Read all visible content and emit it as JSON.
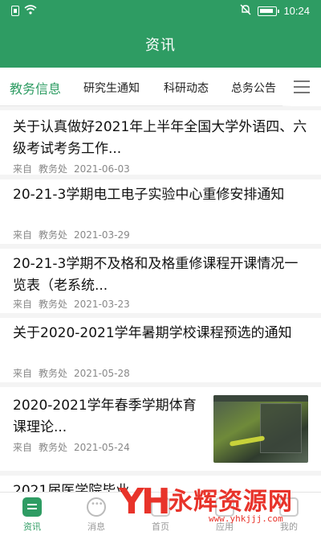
{
  "status": {
    "time": "10:24"
  },
  "header": {
    "title": "资讯"
  },
  "tabs": [
    "教务信息",
    "研究生通知",
    "科研动态",
    "总务公告"
  ],
  "articles": [
    {
      "title": "关于认真做好2021年上半年全国大学外语四、六级考试考务工作...",
      "source_label": "来自",
      "source": "教务处",
      "date": "2021-06-03"
    },
    {
      "title": "20-21-3学期电工电子实验中心重修安排通知",
      "source_label": "来自",
      "source": "教务处",
      "date": "2021-03-29"
    },
    {
      "title": "20-21-3学期不及格和及格重修课程开课情况一览表（老系统...",
      "source_label": "来自",
      "source": "教务处",
      "date": "2021-03-23"
    },
    {
      "title": "关于2020-2021学年暑期学校课程预选的通知",
      "source_label": "来自",
      "source": "教务处",
      "date": "2021-05-28"
    },
    {
      "title": "2020-2021学年春季学期体育课理论...",
      "source_label": "来自",
      "source": "教务处",
      "date": "2021-05-24",
      "has_thumbnail": true
    },
    {
      "title": "2021届医学院毕业",
      "partial": true
    }
  ],
  "bottom_nav": [
    {
      "label": "资讯",
      "icon": "document-icon",
      "active": true
    },
    {
      "label": "消息",
      "icon": "chat-icon"
    },
    {
      "label": "首页",
      "icon": "home-icon"
    },
    {
      "label": "应用",
      "icon": "apps-icon"
    },
    {
      "label": "我的",
      "icon": "user-icon"
    }
  ],
  "watermark": {
    "name": "永辉资源网",
    "url": "www.yhkjjj.com"
  },
  "colors": {
    "primary": "#2e9c63",
    "watermark": "#e8332a"
  }
}
